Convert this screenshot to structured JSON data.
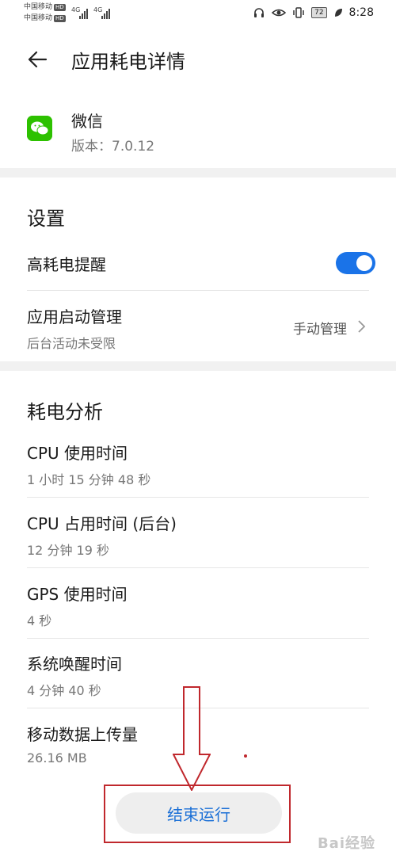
{
  "status_bar": {
    "carrier1": "中国移动",
    "carrier2": "中国移动",
    "hd": "HD",
    "network": "4G",
    "battery": "72",
    "time": "8:28"
  },
  "header": {
    "title": "应用耗电详情"
  },
  "app": {
    "name": "微信",
    "version": "版本：7.0.12",
    "icon": "wechat-icon",
    "icon_color": "#2dc100"
  },
  "settings": {
    "title": "设置",
    "high_power_alert": {
      "label": "高耗电提醒",
      "enabled": true,
      "toggle_color": "#1a73e8"
    },
    "startup_management": {
      "label": "应用启动管理",
      "sub": "后台活动未受限",
      "value": "手动管理"
    }
  },
  "analysis": {
    "title": "耗电分析",
    "items": [
      {
        "label": "CPU 使用时间",
        "value": "1 小时 15 分钟 48 秒"
      },
      {
        "label": "CPU 占用时间 (后台)",
        "value": "12 分钟 19 秒"
      },
      {
        "label": "GPS 使用时间",
        "value": "4 秒"
      },
      {
        "label": "系统唤醒时间",
        "value": "4 分钟 40 秒"
      },
      {
        "label": "移动数据上传量",
        "value": "26.16 MB"
      }
    ]
  },
  "end_button": {
    "label": "结束运行",
    "color": "#1a6fd6"
  },
  "annotation": {
    "color": "#c0282d"
  },
  "watermark": "Bai经验"
}
